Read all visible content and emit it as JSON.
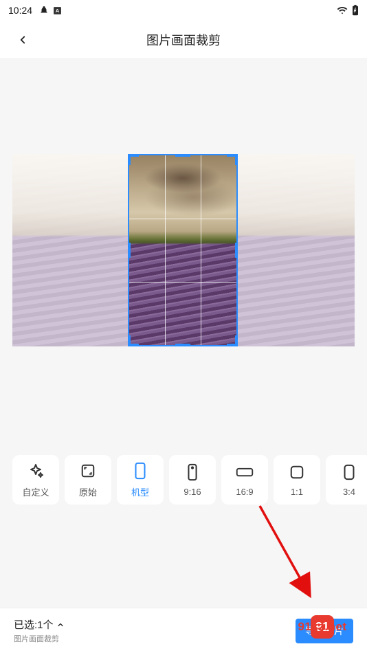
{
  "status": {
    "time": "10:24"
  },
  "header": {
    "title": "图片画面裁剪"
  },
  "ratios": [
    {
      "id": "custom",
      "label": "自定义",
      "icon": "sparkle-icon"
    },
    {
      "id": "original",
      "label": "原始",
      "icon": "expand-icon"
    },
    {
      "id": "device",
      "label": "机型",
      "icon": "phone-icon",
      "active": true
    },
    {
      "id": "9-16",
      "label": "9:16",
      "icon": "phone-dot-icon"
    },
    {
      "id": "16-9",
      "label": "16:9",
      "icon": "wide-rect-icon"
    },
    {
      "id": "1-1",
      "label": "1:1",
      "icon": "square-icon"
    },
    {
      "id": "3-4",
      "label": "3:4",
      "icon": "tall-rect-icon"
    }
  ],
  "footer": {
    "selected_label": "已选:1个",
    "subtitle": "图片画面裁剪",
    "export_label": "导出图片"
  },
  "watermark": {
    "badge": "91",
    "text": "91xz.net"
  },
  "colors": {
    "accent": "#2a8cff",
    "annotation": "#e20f0f"
  }
}
